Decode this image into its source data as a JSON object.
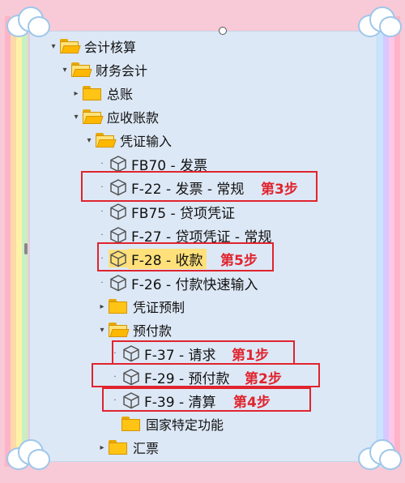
{
  "tree": [
    {
      "id": "n1",
      "label": "会计核算",
      "kind": "folder-open",
      "expand": "▾"
    },
    {
      "id": "n2",
      "label": "财务会计",
      "kind": "folder-open",
      "expand": "▾"
    },
    {
      "id": "n3",
      "label": "总账",
      "kind": "folder",
      "expand": "▸"
    },
    {
      "id": "n4",
      "label": "应收账款",
      "kind": "folder-open",
      "expand": "▾"
    },
    {
      "id": "n5",
      "label": "凭证输入",
      "kind": "folder-open",
      "expand": "▾"
    },
    {
      "id": "n6",
      "label": "FB70 - 发票",
      "kind": "tx",
      "expand": "·"
    },
    {
      "id": "n7",
      "label": "F-22 - 发票 - 常规",
      "kind": "tx",
      "expand": "·"
    },
    {
      "id": "n8",
      "label": "FB75 - 贷项凭证",
      "kind": "tx",
      "expand": "·"
    },
    {
      "id": "n9",
      "label": "F-27 - 贷项凭证 - 常规",
      "kind": "tx",
      "expand": "·"
    },
    {
      "id": "n10",
      "label": "F-28 - 收款",
      "kind": "tx",
      "expand": "·"
    },
    {
      "id": "n11",
      "label": "F-26 - 付款快速输入",
      "kind": "tx",
      "expand": "·"
    },
    {
      "id": "n12",
      "label": "凭证预制",
      "kind": "folder",
      "expand": "▸"
    },
    {
      "id": "n13",
      "label": "预付款",
      "kind": "folder-open",
      "expand": "▾"
    },
    {
      "id": "n14",
      "label": "F-37 - 请求",
      "kind": "tx",
      "expand": "·"
    },
    {
      "id": "n15",
      "label": "F-29 - 预付款",
      "kind": "tx",
      "expand": "·"
    },
    {
      "id": "n16",
      "label": "F-39 - 清算",
      "kind": "tx",
      "expand": "·"
    },
    {
      "id": "n17",
      "label": "国家特定功能",
      "kind": "folder",
      "expand": ""
    },
    {
      "id": "n18",
      "label": "汇票",
      "kind": "folder",
      "expand": "▸"
    }
  ],
  "steps": [
    {
      "id": "s1",
      "label": "第1步"
    },
    {
      "id": "s2",
      "label": "第2步"
    },
    {
      "id": "s3",
      "label": "第3步"
    },
    {
      "id": "s4",
      "label": "第4步"
    },
    {
      "id": "s5",
      "label": "第5步"
    }
  ],
  "colors": {
    "highlight": "#ffe07a",
    "step": "#e0242e",
    "folder": "#ffc414"
  },
  "selected": "F-28 - 收款"
}
